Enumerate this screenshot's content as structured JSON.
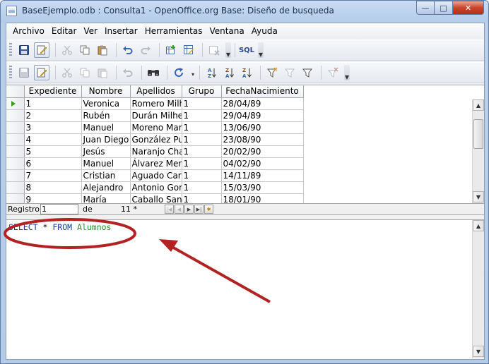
{
  "window": {
    "title": "BaseEjemplo.odb : Consulta1 - OpenOffice.org Base: Diseño de busqueda",
    "min_label": "—",
    "max_label": "□",
    "close_label": "✕"
  },
  "menu": [
    "Archivo",
    "Editar",
    "Ver",
    "Insertar",
    "Herramientas",
    "Ventana",
    "Ayuda"
  ],
  "toolbar1": {
    "icons": [
      "save-icon",
      "edit-mode-icon",
      "cut-icon",
      "copy-icon",
      "paste-icon",
      "undo-icon",
      "redo-icon",
      "add-tables-icon",
      "design-icon",
      "clear-query-icon",
      "sql-icon"
    ],
    "sql_label": "SQL"
  },
  "toolbar2": {
    "icons": [
      "save-record-icon",
      "edit-data-icon",
      "cut-icon",
      "copy-icon",
      "paste-icon",
      "undo-icon",
      "find-record-icon",
      "refresh-icon",
      "sort-ascending-icon",
      "sort-descending-icon",
      "sort-icon",
      "autofilter-icon",
      "standard-filter-icon",
      "apply-filter-icon",
      "remove-filter-icon"
    ]
  },
  "grid": {
    "columns": [
      "Expediente",
      "Nombre",
      "Apellidos",
      "Grupo",
      "FechaNacimiento"
    ],
    "rows": [
      [
        "1",
        "Veronica",
        "Romero Milh",
        "1",
        "28/04/89"
      ],
      [
        "2",
        "Rubén",
        "Durán Milhei",
        "1",
        "29/04/89"
      ],
      [
        "3",
        "Manuel",
        "Moreno Mart",
        "1",
        "13/06/90"
      ],
      [
        "4",
        "Juan Diego",
        "González Puli",
        "1",
        "23/08/90"
      ],
      [
        "5",
        "Jesús",
        "Naranjo Char",
        "1",
        "20/02/90"
      ],
      [
        "6",
        "Manuel",
        "Álvarez Menc",
        "1",
        "04/02/90"
      ],
      [
        "7",
        "Cristian",
        "Aguado Caro",
        "1",
        "14/11/89"
      ],
      [
        "8",
        "Alejandro",
        "Antonio Gon",
        "1",
        "15/03/90"
      ],
      [
        "9",
        "María",
        "Caballo Sant",
        "1",
        "18/01/90"
      ]
    ]
  },
  "recordbar": {
    "registro_label": "Registro",
    "current": "1",
    "de_label": "de",
    "total": "11 *"
  },
  "sql": {
    "keyword1": "SELECT",
    "star": "*",
    "keyword2": "FROM",
    "table": "Alumnos"
  },
  "colors": {
    "annotation": "#b22222",
    "sql_keyword": "#1a3fa8",
    "sql_table": "#2e8b2e",
    "current_row_marker": "#3d9b1a"
  }
}
